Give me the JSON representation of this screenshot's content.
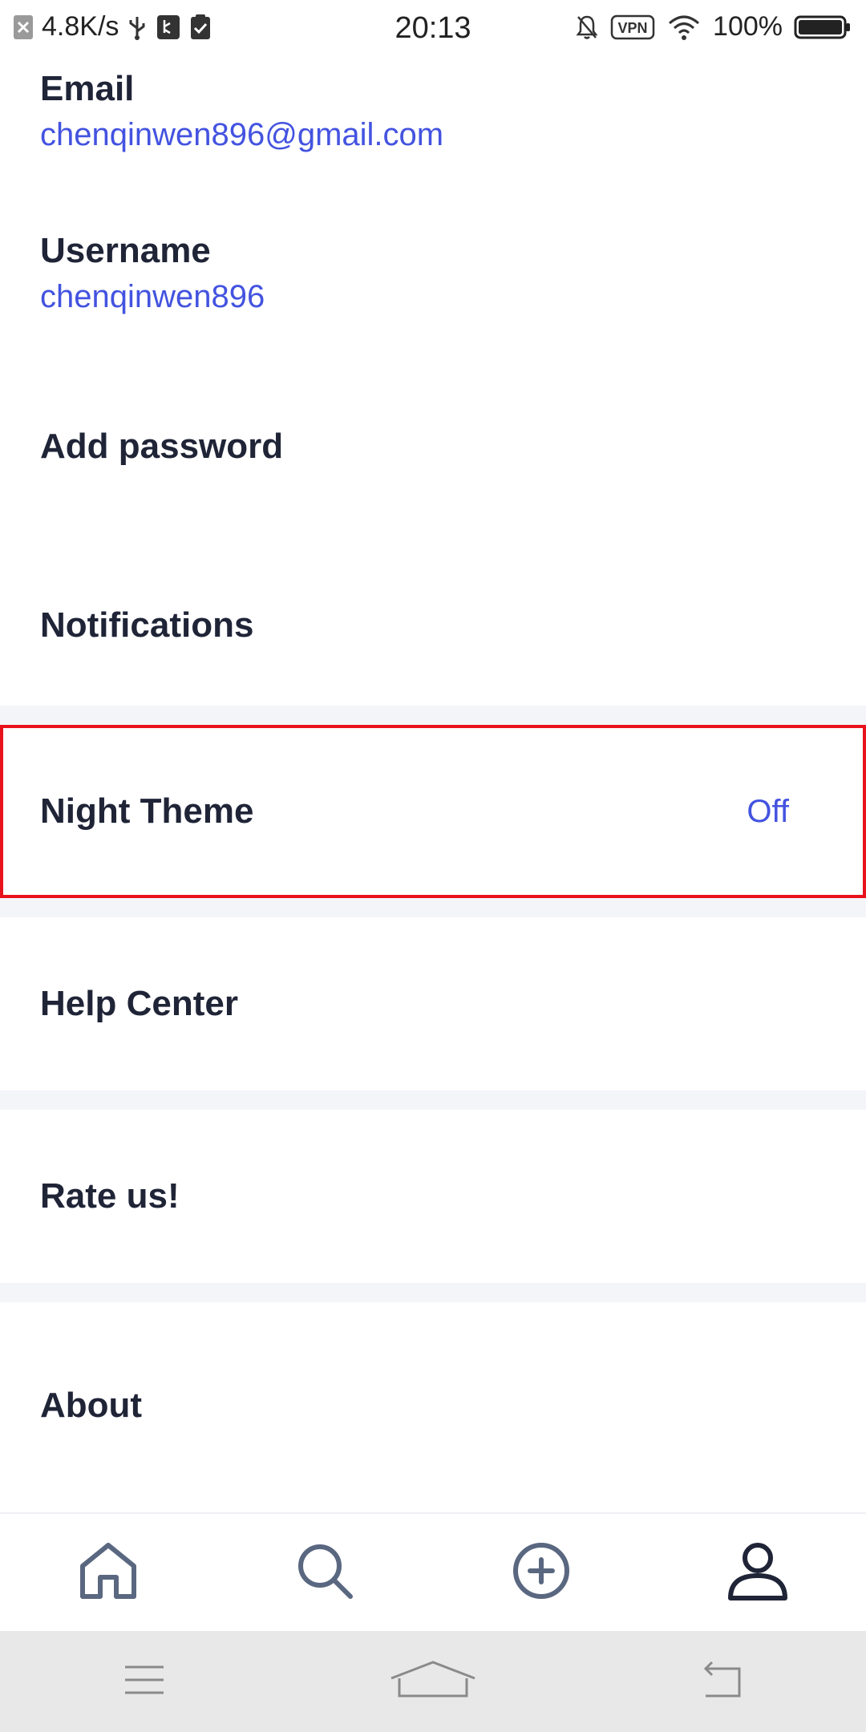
{
  "status_bar": {
    "net_speed": "4.8K/s",
    "time": "20:13",
    "vpn": "VPN",
    "battery": "100%"
  },
  "settings": {
    "email": {
      "label": "Email",
      "value": "chenqinwen896@gmail.com"
    },
    "username": {
      "label": "Username",
      "value": "chenqinwen896"
    },
    "add_password": {
      "label": "Add password"
    },
    "notifications": {
      "label": "Notifications"
    },
    "night_theme": {
      "label": "Night Theme",
      "value": "Off"
    },
    "help_center": {
      "label": "Help Center"
    },
    "rate_us": {
      "label": "Rate us!"
    },
    "about": {
      "label": "About"
    }
  },
  "bottom_nav": {
    "items": [
      "home-icon",
      "search-icon",
      "add-icon",
      "profile-icon"
    ]
  },
  "colors": {
    "accent": "#4353e0",
    "text": "#1f2437",
    "highlight_border": "#e8121c",
    "divider": "#f4f5f9"
  }
}
